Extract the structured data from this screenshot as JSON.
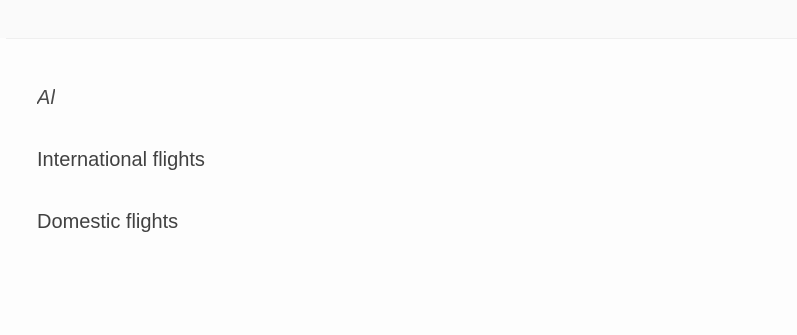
{
  "menu": {
    "items": [
      {
        "label": "Al"
      },
      {
        "label": "International flights"
      },
      {
        "label": "Domestic flights"
      }
    ]
  }
}
